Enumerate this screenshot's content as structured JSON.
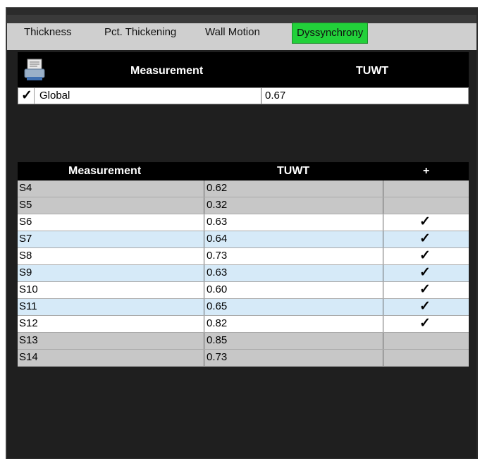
{
  "tabs": [
    {
      "label": "Thickness",
      "active": false
    },
    {
      "label": "Pct. Thickening",
      "active": false
    },
    {
      "label": "Wall Motion",
      "active": false
    },
    {
      "label": "Dyssynchrony",
      "active": true
    }
  ],
  "global_table": {
    "header_measurement": "Measurement",
    "header_tuwt": "TUWT",
    "row_label": "Global",
    "row_value": "0.67",
    "checked": true
  },
  "segment_table": {
    "header_measurement": "Measurement",
    "header_tuwt": "TUWT",
    "header_plus": "+",
    "rows": [
      {
        "name": "S4",
        "value": "0.62",
        "checked": false,
        "style": "grey"
      },
      {
        "name": "S5",
        "value": "0.32",
        "checked": false,
        "style": "grey"
      },
      {
        "name": "S6",
        "value": "0.63",
        "checked": true,
        "style": "white"
      },
      {
        "name": "S7",
        "value": "0.64",
        "checked": true,
        "style": "blue"
      },
      {
        "name": "S8",
        "value": "0.73",
        "checked": true,
        "style": "white"
      },
      {
        "name": "S9",
        "value": "0.63",
        "checked": true,
        "style": "blue"
      },
      {
        "name": "S10",
        "value": "0.60",
        "checked": true,
        "style": "white"
      },
      {
        "name": "S11",
        "value": "0.65",
        "checked": true,
        "style": "blue"
      },
      {
        "name": "S12",
        "value": "0.82",
        "checked": true,
        "style": "white"
      },
      {
        "name": "S13",
        "value": "0.85",
        "checked": false,
        "style": "grey"
      },
      {
        "name": "S14",
        "value": "0.73",
        "checked": false,
        "style": "grey"
      }
    ]
  },
  "colors": {
    "active_tab": "#22d13a",
    "panel_bg": "#1f1f1f",
    "header_bg": "#000000",
    "row_blue": "#d6eaf8",
    "row_grey": "#c7c7c7"
  },
  "check_glyph": "✓"
}
